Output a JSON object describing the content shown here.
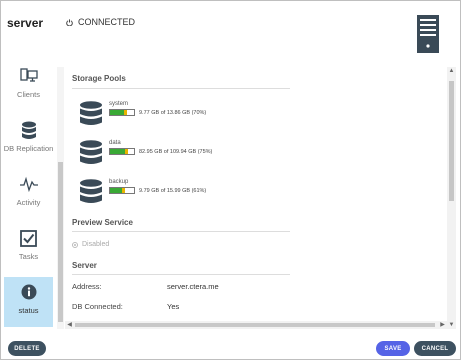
{
  "header": {
    "title": "server",
    "connection_status": "CONNECTED"
  },
  "sidebar": {
    "items": [
      {
        "label": "Clients",
        "icon": "clients-icon",
        "active": false
      },
      {
        "label": "DB Replication",
        "icon": "database-icon",
        "active": false
      },
      {
        "label": "Activity",
        "icon": "activity-icon",
        "active": false
      },
      {
        "label": "Tasks",
        "icon": "tasks-icon",
        "active": false
      },
      {
        "label": "status",
        "icon": "info-icon",
        "active": true
      }
    ]
  },
  "main": {
    "storage_pools_title": "Storage Pools",
    "pools": [
      {
        "name": "system",
        "usage": "9.77 GB of 13.86 GB (70%)",
        "percent": 70
      },
      {
        "name": "data",
        "usage": "82.95 GB of 109.94 GB (75%)",
        "percent": 75
      },
      {
        "name": "backup",
        "usage": "9.79 GB of 15.99 GB (61%)",
        "percent": 61
      }
    ],
    "preview_service_title": "Preview Service",
    "preview_status": "Disabled",
    "server_title": "Server",
    "address_label": "Address:",
    "address_value": "server.ctera.me",
    "db_connected_label": "DB Connected:",
    "db_connected_value": "Yes"
  },
  "footer": {
    "delete_label": "DELETE",
    "save_label": "SAVE",
    "cancel_label": "CANCEL"
  },
  "colors": {
    "accent": "#5563e6",
    "dark_button": "#3d5160",
    "active_nav": "#bfe2f6",
    "usage_green": "#39a935",
    "usage_warn": "#e8b400",
    "icon_dark": "#3a4a57"
  }
}
